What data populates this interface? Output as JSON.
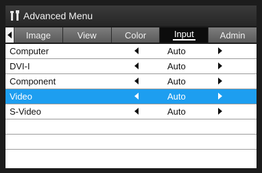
{
  "title_bar": {
    "title": "Advanced Menu",
    "icon": "wrench-screwdriver-icon"
  },
  "tabs": [
    {
      "label": "Image",
      "active": false
    },
    {
      "label": "View",
      "active": false
    },
    {
      "label": "Color",
      "active": false
    },
    {
      "label": "Input",
      "active": true
    },
    {
      "label": "Admin",
      "active": false
    }
  ],
  "rows": [
    {
      "label": "Computer",
      "value": "Auto"
    },
    {
      "label": "DVI-I",
      "value": "Auto"
    },
    {
      "label": "Component",
      "value": "Auto"
    },
    {
      "label": "Video",
      "value": "Auto",
      "selected": true
    },
    {
      "label": "S-Video",
      "value": "Auto"
    }
  ],
  "colors": {
    "accent": "#1d9ef0",
    "background": "#1c1c1c",
    "list_background": "#ffffff"
  }
}
